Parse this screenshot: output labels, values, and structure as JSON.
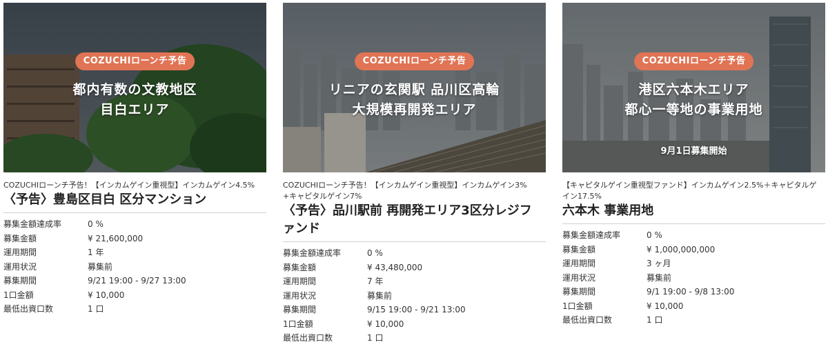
{
  "cards": [
    {
      "badge": "COZUCHIローンチ予告",
      "headline_lines": [
        "都内有数の文教地区",
        "目白エリア"
      ],
      "start_text": "",
      "category": "COZUCHIローンチ予告！【インカムゲイン重視型】インカムゲイン4.5%",
      "title": "〈予告〉豊島区目白 区分マンション",
      "specs": [
        {
          "label": "募集金額達成率",
          "value": "0 %"
        },
        {
          "label": "募集金額",
          "value": "¥ 21,600,000"
        },
        {
          "label": "運用期間",
          "value": "1 年"
        },
        {
          "label": "運用状況",
          "value": "募集前"
        },
        {
          "label": "募集期間",
          "value": "9/21 19:00 - 9/27 13:00"
        },
        {
          "label": "1口金額",
          "value": "¥ 10,000"
        },
        {
          "label": "最低出資口数",
          "value": "1 口"
        }
      ]
    },
    {
      "badge": "COZUCHIローンチ予告",
      "headline_lines": [
        "リニアの玄関駅 品川区高輪",
        "大規模再開発エリア"
      ],
      "start_text": "",
      "category": "COZUCHIローンチ予告！【インカムゲイン重視型】インカムゲイン3% +キャピタルゲイン7%",
      "title": "〈予告〉品川駅前 再開発エリア3区分レジファンド",
      "specs": [
        {
          "label": "募集金額達成率",
          "value": "0 %"
        },
        {
          "label": "募集金額",
          "value": "¥ 43,480,000"
        },
        {
          "label": "運用期間",
          "value": "7 年"
        },
        {
          "label": "運用状況",
          "value": "募集前"
        },
        {
          "label": "募集期間",
          "value": "9/15 19:00 - 9/21 13:00"
        },
        {
          "label": "1口金額",
          "value": "¥ 10,000"
        },
        {
          "label": "最低出資口数",
          "value": "1 口"
        }
      ]
    },
    {
      "badge": "COZUCHIローンチ予告",
      "headline_lines": [
        "港区六本木エリア",
        "都心一等地の事業用地"
      ],
      "start_text": "9月1日募集開始",
      "category": "【キャピタルゲイン重視型ファンド】インカムゲイン2.5%＋キャピタルゲイン17.5%",
      "title": "六本木 事業用地",
      "specs": [
        {
          "label": "募集金額達成率",
          "value": "0 %"
        },
        {
          "label": "募集金額",
          "value": "¥ 1,000,000,000"
        },
        {
          "label": "運用期間",
          "value": "3 ヶ月"
        },
        {
          "label": "運用状況",
          "value": "募集前"
        },
        {
          "label": "募集期間",
          "value": "9/1 19:00 - 9/8 13:00"
        },
        {
          "label": "1口金額",
          "value": "¥ 10,000"
        },
        {
          "label": "最低出資口数",
          "value": "1 口"
        }
      ]
    }
  ],
  "colors": {
    "badge": "#e07455",
    "divider": "#cfcfcf"
  }
}
